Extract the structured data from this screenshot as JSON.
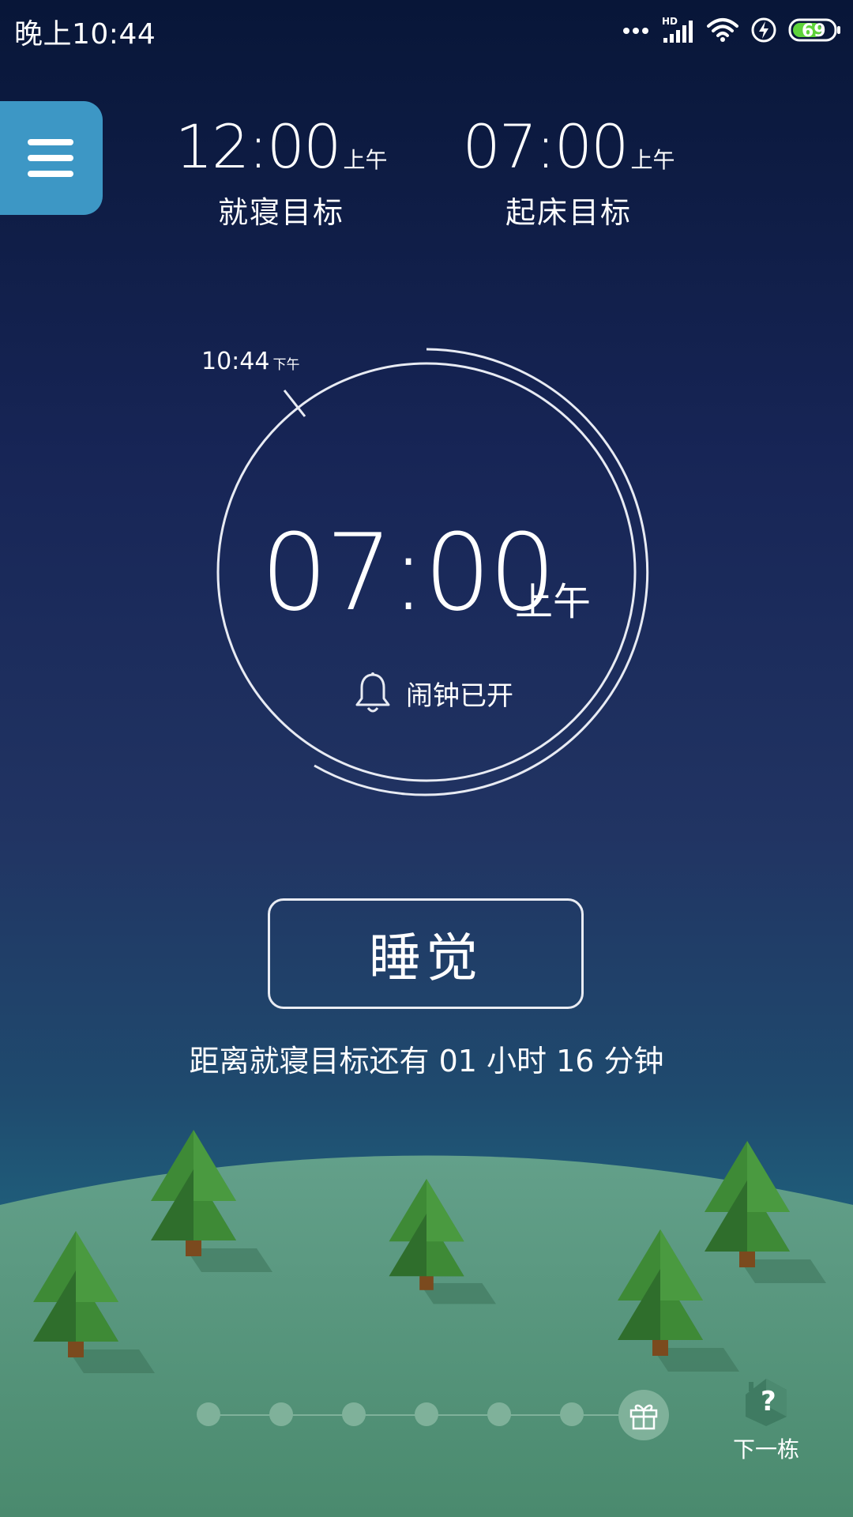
{
  "status_bar": {
    "time": "晚上10:44",
    "network_badge": "HD",
    "battery_level": "69",
    "icons": [
      "dots-icon",
      "signal-icon",
      "wifi-icon",
      "charging-icon",
      "battery-icon"
    ]
  },
  "menu": {
    "icon": "hamburger-menu-icon"
  },
  "goals": {
    "bedtime": {
      "time": "12:00",
      "ampm": "上午",
      "label": "就寝目标"
    },
    "wakeup": {
      "time": "07:00",
      "ampm": "上午",
      "label": "起床目标"
    }
  },
  "clock": {
    "now_time": "10:44",
    "now_ampm": "下午",
    "alarm_time": "07:00",
    "alarm_ampm": "上午",
    "alarm_status": "闹钟已开"
  },
  "sleep_button_label": "睡觉",
  "countdown_text": "距离就寝目标还有 01 小时 16 分钟",
  "progress": {
    "total_steps": 7,
    "current_step": 0,
    "reward_icon": "gift-icon"
  },
  "next_building": {
    "label": "下一栋",
    "icon": "mystery-house-icon"
  },
  "colors": {
    "menu_bg": "#3d97c5",
    "hill": "#5b9a82",
    "tree_dark": "#2f6e2c",
    "tree_light": "#3e8a36",
    "battery_fill": "#5ed33a"
  }
}
